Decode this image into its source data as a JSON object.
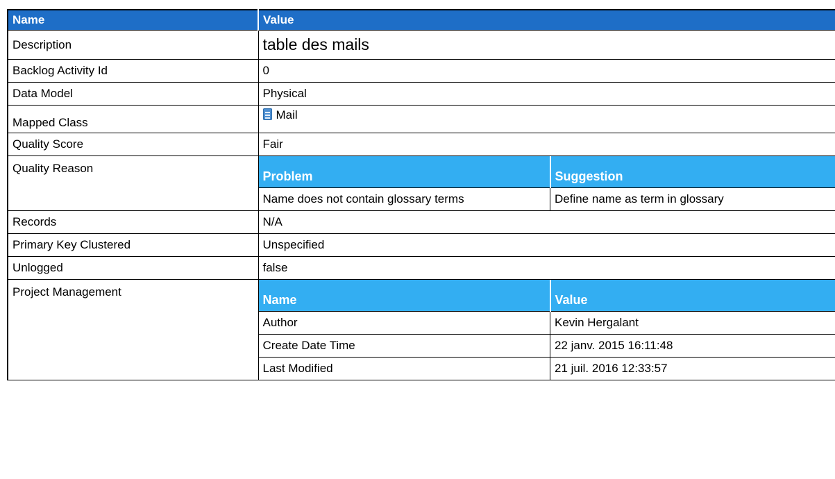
{
  "header": {
    "name_label": "Name",
    "value_label": "Value"
  },
  "rows": {
    "description": {
      "label": "Description",
      "value": "table des mails"
    },
    "backlog": {
      "label": "Backlog Activity Id",
      "value": "0"
    },
    "data_model": {
      "label": "Data Model",
      "value": "Physical"
    },
    "mapped_class": {
      "label": "Mapped Class",
      "value": "Mail",
      "icon": "class-document-icon"
    },
    "quality_score": {
      "label": "Quality Score",
      "value": "Fair"
    },
    "quality_reason": {
      "label": "Quality Reason",
      "headers": [
        "Problem",
        "Suggestion"
      ],
      "rows": [
        [
          "Name does not contain glossary terms",
          "Define name as term in glossary"
        ]
      ]
    },
    "records": {
      "label": "Records",
      "value": "N/A"
    },
    "pk_clustered": {
      "label": "Primary Key Clustered",
      "value": "Unspecified"
    },
    "unlogged": {
      "label": "Unlogged",
      "value": "false"
    },
    "project_mgmt": {
      "label": "Project Management",
      "headers": [
        "Name",
        "Value"
      ],
      "rows": [
        [
          "Author",
          "Kevin Hergalant"
        ],
        [
          "Create Date Time",
          "22 janv. 2015 16:11:48"
        ],
        [
          "Last Modified",
          "21 juil. 2016 12:33:57"
        ]
      ]
    }
  },
  "colors": {
    "header_bg": "#1e6ec7",
    "subheader_bg": "#33aef2",
    "icon": "#4d8ed0"
  }
}
